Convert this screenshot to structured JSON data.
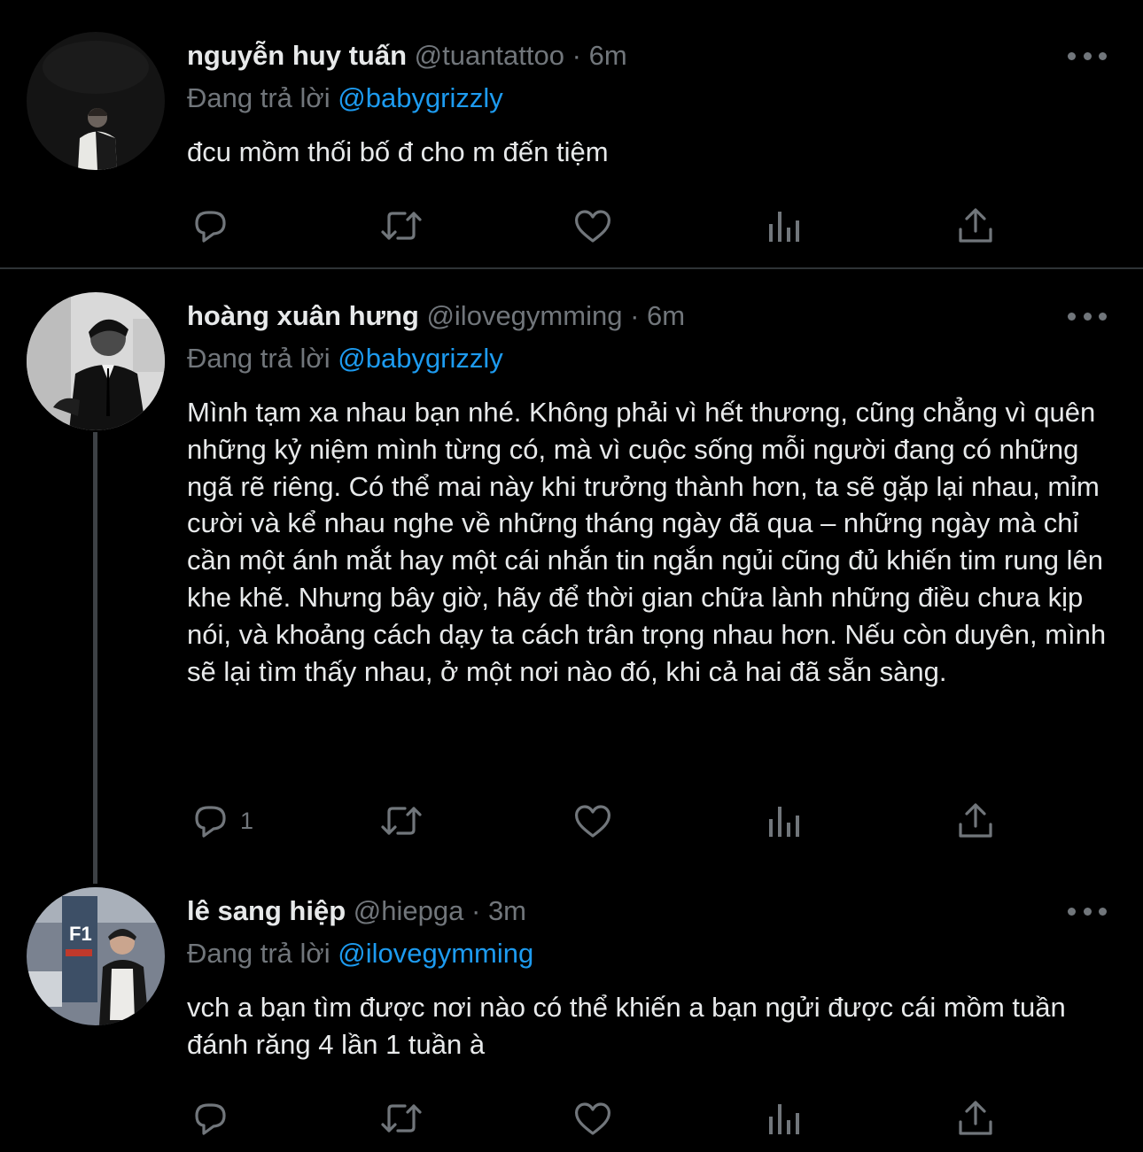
{
  "colors": {
    "background": "#000000",
    "text": "#e7e9ea",
    "secondary": "#71767b",
    "link": "#1d9bf0",
    "divider": "#2f3336"
  },
  "action_icons": [
    "reply-icon",
    "retweet-icon",
    "like-icon",
    "views-icon",
    "share-icon"
  ],
  "tweets": [
    {
      "name": "nguyễn huy tuấn",
      "handle": "@tuantattoo",
      "separator": "·",
      "time": "6m",
      "replying_prefix": "Đang trả lời",
      "replying_to": "@babygrizzly",
      "text": "đcu mồm thối bố đ cho m đến tiệm",
      "reply_count": ""
    },
    {
      "name": "hoàng xuân hưng",
      "handle": "@ilovegymming",
      "separator": "·",
      "time": "6m",
      "replying_prefix": "Đang trả lời",
      "replying_to": "@babygrizzly",
      "text": "Mình tạm xa nhau bạn nhé. Không phải vì hết thương, cũng chẳng vì quên những kỷ niệm mình từng có, mà vì cuộc sống mỗi người đang có những ngã rẽ riêng. Có thể mai này khi trưởng thành hơn, ta sẽ gặp lại nhau, mỉm cười và kể nhau nghe về những tháng ngày đã qua – những ngày mà chỉ cần một ánh mắt hay một cái nhắn tin ngắn ngủi cũng đủ khiến tim rung lên khe khẽ. Nhưng bây giờ, hãy để thời gian chữa lành những điều chưa kịp nói, và khoảng cách dạy ta cách trân trọng nhau hơn. Nếu còn duyên, mình sẽ lại tìm thấy nhau, ở một nơi nào đó, khi cả hai đã sẵn sàng.",
      "reply_count": "1"
    },
    {
      "name": "lê sang hiệp",
      "handle": "@hiepga",
      "separator": "·",
      "time": "3m",
      "replying_prefix": "Đang trả lời",
      "replying_to": "@ilovegymming",
      "text": "vch a bạn tìm được nơi nào có thể khiến a bạn ngửi được cái mồm tuần đánh răng 4 lần 1 tuần à",
      "reply_count": ""
    }
  ]
}
